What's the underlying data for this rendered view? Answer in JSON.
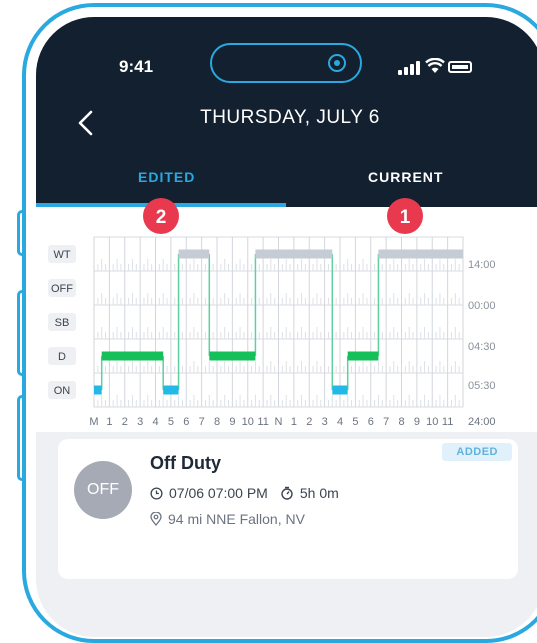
{
  "status_bar": {
    "time": "9:41"
  },
  "header": {
    "title": "THURSDAY, JULY 6"
  },
  "tabs": [
    {
      "label": "EDITED",
      "active": true
    },
    {
      "label": "CURRENT",
      "active": false
    }
  ],
  "markers": {
    "edited": "2",
    "current": "1"
  },
  "chart_data": {
    "type": "line",
    "title": "",
    "y_categories": [
      "WT",
      "OFF",
      "SB",
      "D",
      "ON"
    ],
    "x_tick_labels": [
      "M",
      "1",
      "2",
      "3",
      "4",
      "5",
      "6",
      "7",
      "8",
      "9",
      "10",
      "11",
      "N",
      "1",
      "2",
      "3",
      "4",
      "5",
      "6",
      "7",
      "8",
      "9",
      "10",
      "11"
    ],
    "totals": [
      "14:00",
      "00:00",
      "04:30",
      "05:30"
    ],
    "total_label": "24:00",
    "segments": [
      {
        "status": "ON",
        "start": 0,
        "end": 0.5
      },
      {
        "status": "D",
        "start": 0.5,
        "end": 4.5
      },
      {
        "status": "ON",
        "start": 4.5,
        "end": 5.5
      },
      {
        "status": "WT",
        "start": 5.5,
        "end": 7.5
      },
      {
        "status": "D",
        "start": 7.5,
        "end": 10.5
      },
      {
        "status": "WT",
        "start": 10.5,
        "end": 15.5
      },
      {
        "status": "ON",
        "start": 15.5,
        "end": 16.5
      },
      {
        "status": "D",
        "start": 16.5,
        "end": 18.5
      },
      {
        "status": "WT",
        "start": 18.5,
        "end": 24
      }
    ],
    "colors": {
      "WT": "#c5ccd6",
      "D": "#15c05a",
      "ON": "#22b9e6",
      "connector": "#5fcfa0"
    },
    "grid": true
  },
  "card": {
    "avatar": "OFF",
    "badge": "ADDED",
    "title": "Off Duty",
    "datetime": "07/06 07:00 PM",
    "duration": "5h 0m",
    "location": "94 mi NNE Fallon, NV"
  }
}
